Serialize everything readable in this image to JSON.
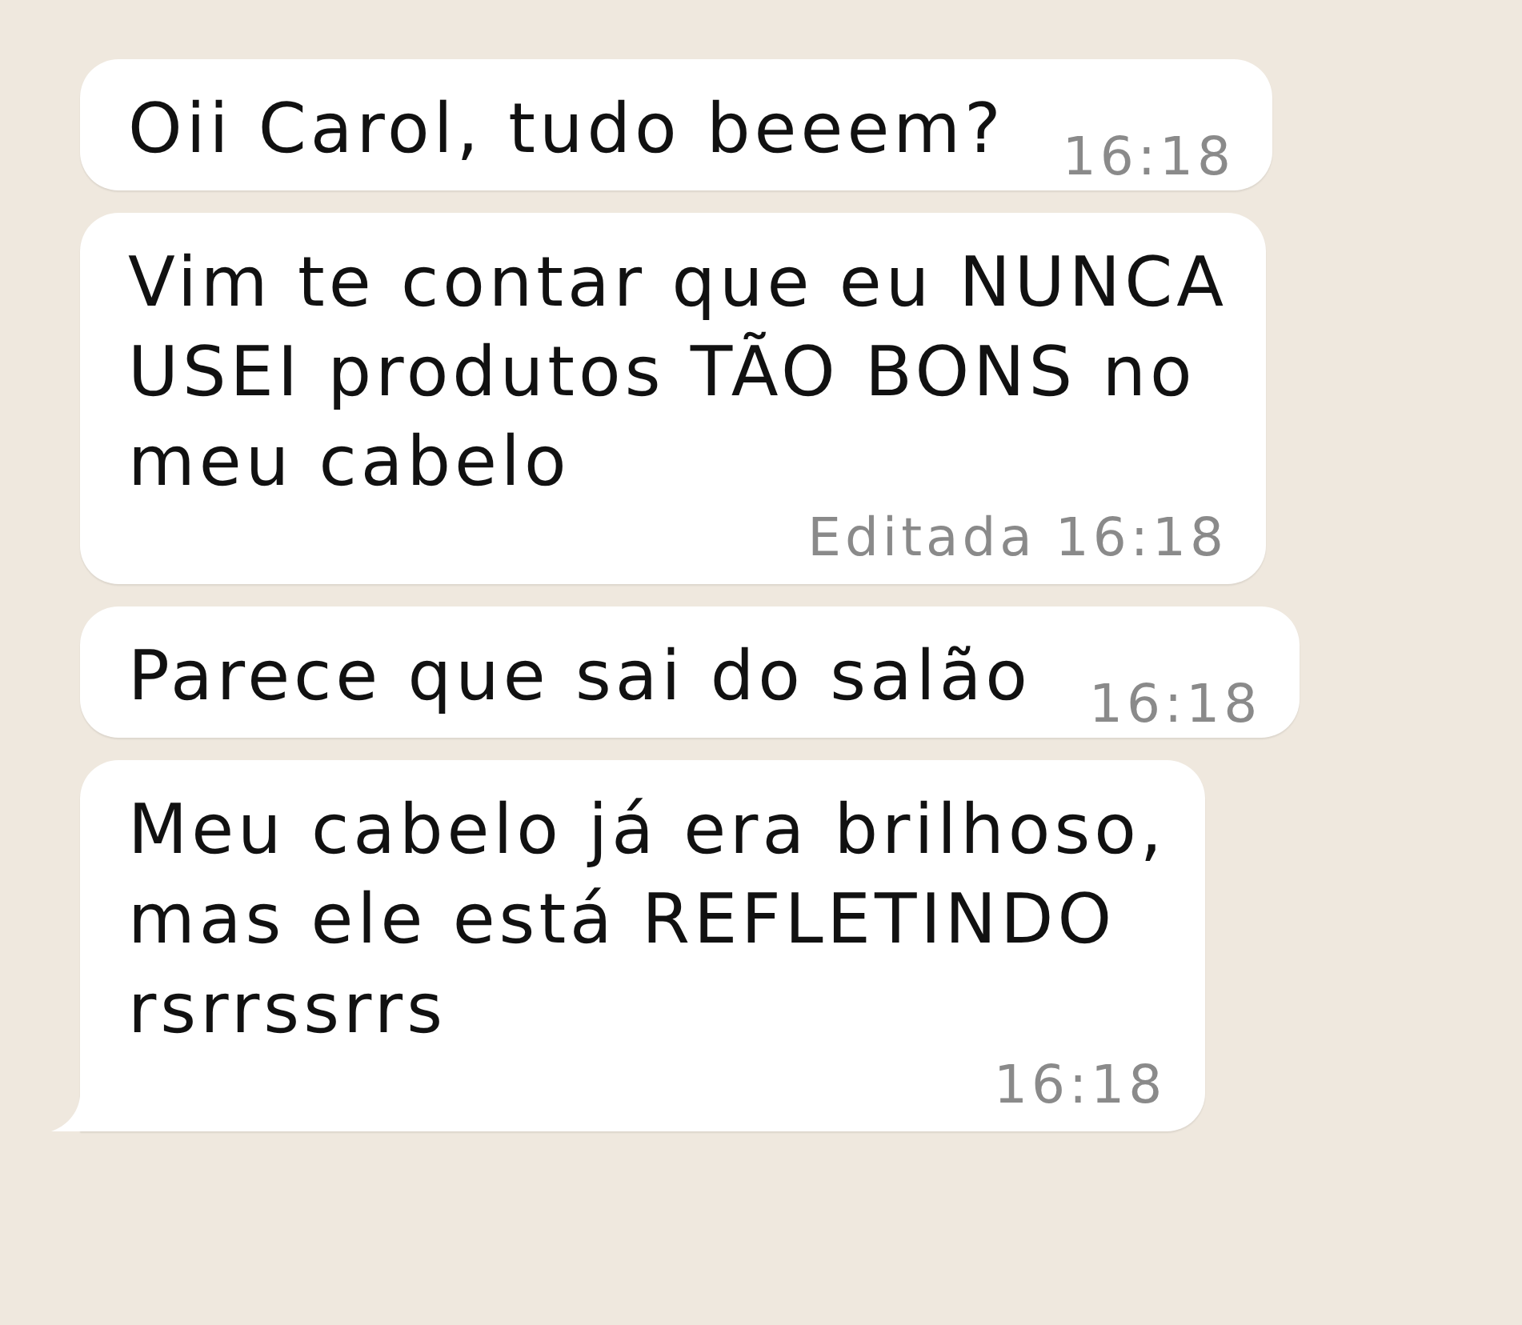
{
  "messages": [
    {
      "text": "Oii Carol, tudo beeem?",
      "time": "16:18",
      "edited": false,
      "tail": false
    },
    {
      "text": "Vim te contar que eu NUNCA\nUSEI produtos TÃO BONS no\nmeu cabelo",
      "edited_label": "Editada",
      "time": "16:18",
      "edited": true,
      "tail": false
    },
    {
      "text": "Parece que sai do salão",
      "time": "16:18",
      "edited": false,
      "tail": false
    },
    {
      "text": "Meu cabelo já era brilhoso,\nmas ele está REFLETINDO\nrsrrssrrs",
      "time": "16:18",
      "edited": false,
      "tail": true
    }
  ]
}
